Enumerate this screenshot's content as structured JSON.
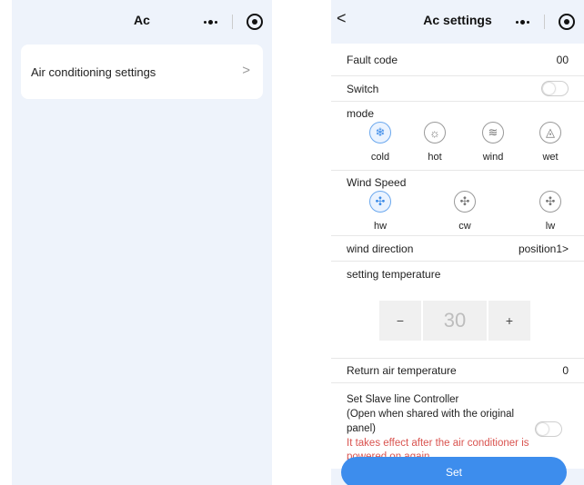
{
  "left": {
    "nav_title": "Ac",
    "item_label": "Air conditioning settings"
  },
  "right": {
    "nav_title": "Ac settings",
    "fault_code_label": "Fault code",
    "fault_code_value": "00",
    "switch_label": "Switch",
    "switch_on": false,
    "mode_label": "mode",
    "modes": [
      {
        "label": "cold",
        "icon": "snowflake-icon",
        "active": true
      },
      {
        "label": "hot",
        "icon": "sun-icon",
        "active": false
      },
      {
        "label": "wind",
        "icon": "wind-icon",
        "active": false
      },
      {
        "label": "wet",
        "icon": "droplet-icon",
        "active": false
      }
    ],
    "wind_speed_label": "Wind Speed",
    "wind_speeds": [
      {
        "label": "hw",
        "icon": "fan-icon",
        "active": true
      },
      {
        "label": "cw",
        "icon": "fan-icon",
        "active": false
      },
      {
        "label": "lw",
        "icon": "fan-icon",
        "active": false
      }
    ],
    "wind_direction_label": "wind direction",
    "wind_direction_value": "position1>",
    "setting_temp_label": "setting temperature",
    "temp_minus": "−",
    "temp_value": "30",
    "temp_plus": "+",
    "return_air_label": "Return air temperature",
    "return_air_value": "0",
    "slave_line1": "Set Slave line Controller",
    "slave_line2": "(Open when shared with the original",
    "slave_line3": "panel)",
    "slave_switch_on": false,
    "hint_line1": "It takes effect after the air conditioner is",
    "hint_line2": "powered on again",
    "set_button": "Set"
  },
  "colors": {
    "accent": "#3d8ded",
    "page_bg": "#eef3fb",
    "warning": "#d9534f"
  }
}
